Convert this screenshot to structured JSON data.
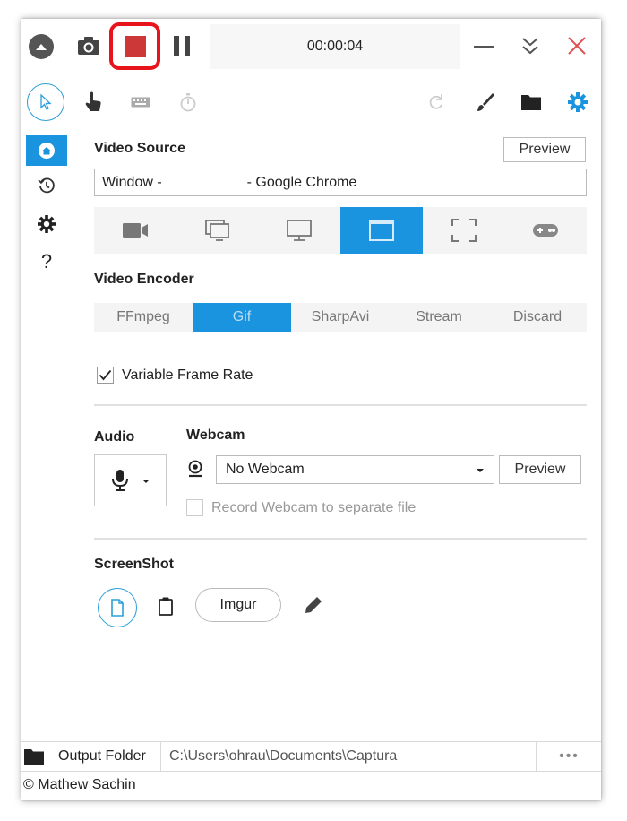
{
  "titlebar": {
    "timer": "00:00:04",
    "icons": [
      "collapse-up-icon",
      "camera-icon",
      "stop-icon",
      "pause-icon",
      "minimize-icon",
      "chevron-double-down-icon",
      "close-icon"
    ]
  },
  "toolbar": {
    "left_icons": [
      "cursor-icon",
      "hand-pointer-icon",
      "keyboard-icon",
      "stopwatch-icon"
    ],
    "right_icons": [
      "refresh-icon",
      "brush-icon",
      "folder-icon",
      "gear-icon"
    ]
  },
  "sidebar": {
    "items": [
      {
        "icon": "home-icon",
        "active": true
      },
      {
        "icon": "history-icon",
        "active": false
      },
      {
        "icon": "settings-icon",
        "active": false
      },
      {
        "icon": "help-icon",
        "label": "?",
        "active": false
      }
    ]
  },
  "video_source": {
    "title": "Video Source",
    "preview_label": "Preview",
    "window_prefix": "Window -",
    "window_suffix": "- Google Chrome",
    "icons": [
      "webcam-source-icon",
      "screens-icon",
      "monitor-icon",
      "window-icon",
      "region-icon",
      "gamepad-icon"
    ],
    "selected_index": 3
  },
  "video_encoder": {
    "title": "Video Encoder",
    "options": [
      "FFmpeg",
      "Gif",
      "SharpAvi",
      "Stream",
      "Discard"
    ],
    "selected": "Gif",
    "variable_frame_rate_label": "Variable Frame Rate",
    "variable_frame_rate_checked": true
  },
  "audio": {
    "title": "Audio"
  },
  "webcam": {
    "title": "Webcam",
    "selected": "No Webcam",
    "preview_label": "Preview",
    "separate_file_label": "Record Webcam to separate file",
    "separate_file_checked": false
  },
  "screenshot": {
    "title": "ScreenShot",
    "imgur_label": "Imgur"
  },
  "footer": {
    "output_folder_label": "Output Folder",
    "output_path": "C:\\Users\\ohrau\\Documents\\Captura",
    "more_label": "•••",
    "credit": "© Mathew Sachin"
  },
  "colors": {
    "accent": "#1b94e0",
    "stop_highlight": "#e8141b",
    "stop_fill": "#cc3838",
    "close": "#e05050"
  }
}
